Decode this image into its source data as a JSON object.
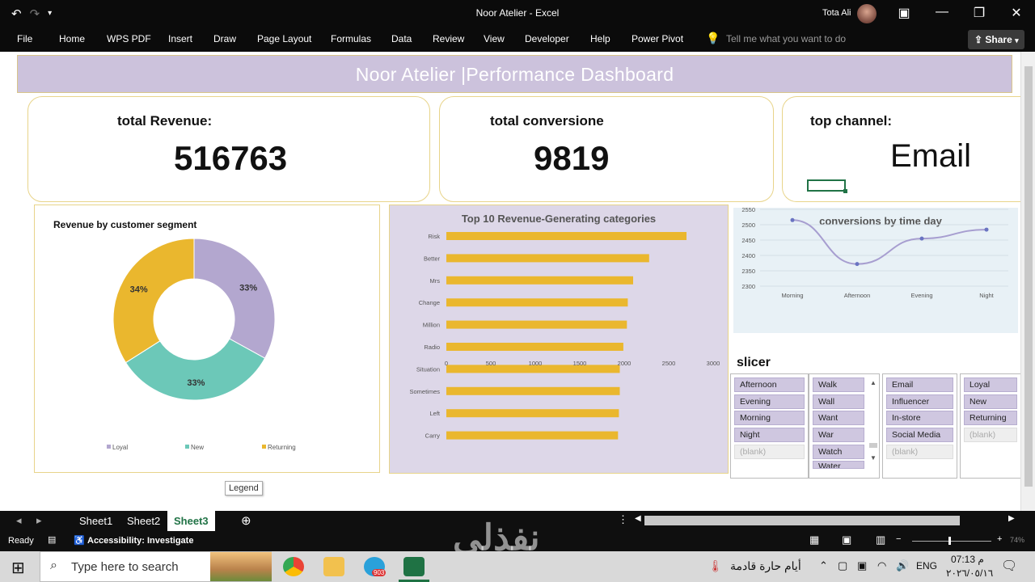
{
  "window": {
    "title": "Noor Atelier  -  Excel",
    "user": "Tota Ali",
    "undo_glyph": "↶",
    "redo_glyph": "↷",
    "more_glyph": "▾",
    "minimize": "—",
    "restore": "❐",
    "close": "✕",
    "ribbon_display": "▣"
  },
  "ribbon": {
    "tabs": [
      "File",
      "Home",
      "WPS PDF",
      "Insert",
      "Draw",
      "Page Layout",
      "Formulas",
      "Data",
      "Review",
      "View",
      "Developer",
      "Help",
      "Power Pivot"
    ],
    "tell_me": "Tell me what you want to do",
    "share": "Share"
  },
  "dashboard": {
    "title": "Noor Atelier |Performance Dashboard",
    "kpis": [
      {
        "label": "total Revenue:",
        "value": "516763"
      },
      {
        "label": "total conversione",
        "value": "9819"
      },
      {
        "label": "top channel:",
        "value": "Email"
      }
    ],
    "legend_tooltip": "Legend",
    "slicer_title": "slicer"
  },
  "chart_data": [
    {
      "type": "pie",
      "title": "Revenue by customer segment",
      "labels": [
        "Loyal",
        "New",
        "Returning"
      ],
      "values": [
        33,
        33,
        34
      ],
      "data_labels": [
        "33%",
        "33%",
        "34%"
      ],
      "colors": [
        "#b3a7cf",
        "#6cc8b8",
        "#eab72e"
      ],
      "legend": "bottom"
    },
    {
      "type": "bar",
      "orientation": "horizontal",
      "title": "Top 10 Revenue-Generating categories",
      "categories": [
        "Risk",
        "Better",
        "Mrs",
        "Change",
        "Million",
        "Radio",
        "Situation",
        "Sometimes",
        "Left",
        "Carry"
      ],
      "values": [
        2700,
        2280,
        2100,
        2040,
        2030,
        1990,
        1950,
        1950,
        1940,
        1930
      ],
      "xlim": [
        0,
        3000
      ],
      "xticks": [
        "0",
        "500",
        "1000",
        "1500",
        "2000",
        "2500",
        "3000"
      ],
      "color": "#eab72e"
    },
    {
      "type": "line",
      "title": "conversions by time day",
      "categories": [
        "Morning",
        "Afternoon",
        "Evening",
        "Night"
      ],
      "values": [
        2515,
        2372,
        2455,
        2484
      ],
      "ylim": [
        2300,
        2550
      ],
      "yticks": [
        "2550",
        "2500",
        "2450",
        "2400",
        "2350",
        "2300"
      ],
      "color": "#a79ed0",
      "grid": true
    }
  ],
  "slicers": [
    {
      "items": [
        "Afternoon",
        "Evening",
        "Morning",
        "Night"
      ],
      "blank": "(blank)"
    },
    {
      "items": [
        "Walk",
        "Wall",
        "Want",
        "War",
        "Watch",
        "Water"
      ]
    },
    {
      "items": [
        "Email",
        "Influencer",
        "In-store",
        "Social Media"
      ],
      "blank": "(blank)"
    },
    {
      "items": [
        "Loyal",
        "New",
        "Returning"
      ],
      "blank": "(blank)"
    }
  ],
  "sheets": [
    "Sheet1",
    "Sheet2",
    "Sheet3"
  ],
  "active_sheet": "Sheet3",
  "status": {
    "ready": "Ready",
    "accessibility": "Accessibility: Investigate",
    "zoom": "74%"
  },
  "taskbar": {
    "search_placeholder": "Type here to search",
    "weather": "أيام حارة قادمة",
    "lang": "ENG",
    "time": "07:13 م",
    "date": "٢٠٢٦/٠٥/١٦",
    "telegram_badge": "903"
  },
  "watermark": "نفذلي"
}
